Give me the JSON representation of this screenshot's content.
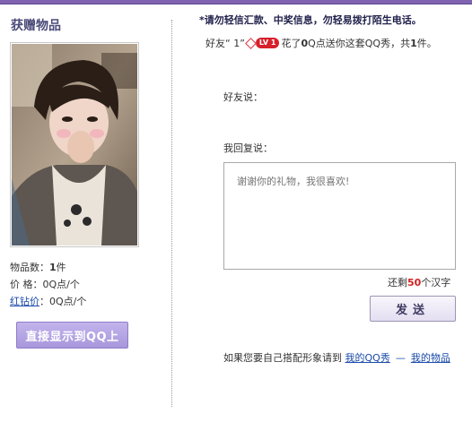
{
  "left": {
    "title": "获赠物品",
    "item_count_label": "物品数：",
    "item_count_value": "1",
    "item_count_unit": "件",
    "price_label": "价  格：",
    "price_value": "0Q点/个",
    "red_diamond_label": "红钻价",
    "red_diamond_value": "：0Q点/个",
    "direct_show_button": "直接显示到QQ上"
  },
  "right": {
    "warning": "*请勿轻信汇款、中奖信息，勿轻易拨打陌生电话。",
    "gift_prefix": "好友“ 1”",
    "level_badge": "LV 1",
    "gift_mid": "花了",
    "gift_qpoints": "0",
    "gift_mid2": "Q点送你这套QQ秀，共",
    "gift_count": "1",
    "gift_suffix": "件。",
    "friend_says_label": "好友说：",
    "my_reply_label": "我回复说：",
    "reply_placeholder": "谢谢你的礼物，我很喜欢!",
    "remaining_prefix": "还剩",
    "remaining_count": "50",
    "remaining_suffix": "个汉字",
    "send_button": "发送",
    "bottom_note_prefix": "如果您要自己搭配形象请到",
    "link_my_qqshow": "我的QQ秀",
    "link_separator": "—",
    "link_my_items": "我的物品"
  },
  "colors": {
    "topbar": "#7f62b0",
    "title": "#4b4b79",
    "button_purple": "#a897dc",
    "badge_red": "#d81f2c",
    "link_blue": "#1a4aa8"
  }
}
